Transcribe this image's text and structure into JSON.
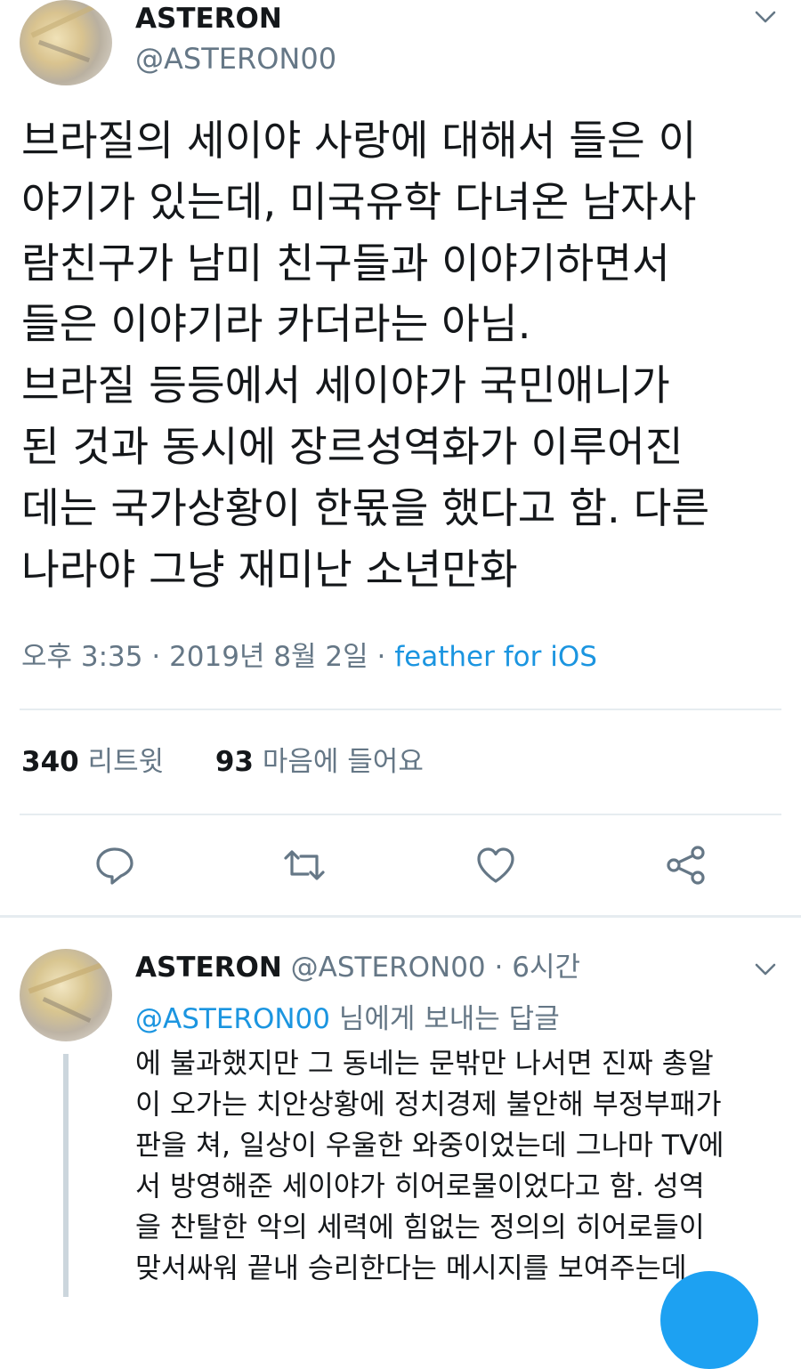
{
  "main_tweet": {
    "display_name": "ASTERON",
    "handle": "@ASTERON00",
    "body_lines": [
      "브라질의 세이야 사랑에 대해서 들은 이",
      "야기가 있는데, 미국유학 다녀온 남자사",
      "람친구가 남미 친구들과 이야기하면서",
      "들은 이야기라 카더라는 아님.",
      "브라질 등등에서 세이야가 국민애니가",
      "된 것과 동시에 장르성역화가 이루어진",
      "데는 국가상황이 한몫을 했다고 함. 다른",
      "나라야 그냥 재미난 소년만화"
    ],
    "timestamp": "오후 3:35 · 2019년 8월 2일",
    "separator": "·",
    "source": "feather for iOS",
    "retweets_count": "340",
    "retweets_label": "리트윗",
    "likes_count": "93",
    "likes_label": "마음에 들어요"
  },
  "reply_tweet": {
    "display_name": "ASTERON",
    "handle": "@ASTERON00",
    "dot": "·",
    "time_ago": "6시간",
    "replying_to_mention": "@ASTERON00",
    "replying_to_suffix": "님에게 보내는 답글",
    "body_lines": [
      "에 불과했지만 그 동네는 문밖만 나서면 진짜 총알",
      "이 오가는 치안상황에 정치경제 불안해 부정부패가",
      "판을 쳐, 일상이 우울한 와중이었는데 그나마 TV에",
      "서 방영해준 세이야가 히어로물이었다고 함. 성역",
      "을 찬탈한 악의 세력에 힘없는 정의의 히어로들이",
      "맞서싸워 끝내 승리한다는 메시지를 보여주는데"
    ]
  },
  "icons": {
    "menu": "chevron-down-icon",
    "reply": "reply-icon",
    "retweet": "retweet-icon",
    "like": "heart-icon",
    "share": "share-icon",
    "compose": "compose-fab"
  },
  "colors": {
    "link": "#1b95e0",
    "secondary_text": "#657786",
    "divider": "#e6ecf0",
    "fab": "#1da1f2"
  }
}
